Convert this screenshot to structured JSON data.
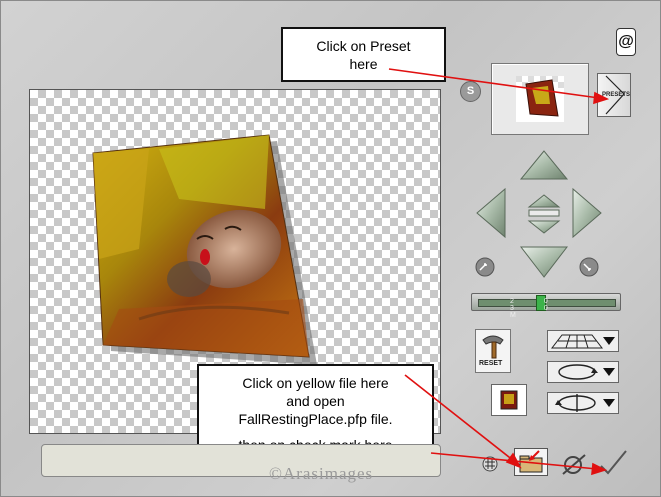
{
  "window": {
    "logo": "@"
  },
  "callouts": {
    "preset": {
      "lines": [
        "Click on Preset",
        "here"
      ]
    },
    "file": {
      "lines": [
        "Click on yellow file here",
        "and open",
        "FallRestingPlace.pfp file.",
        "then on check mark here"
      ]
    }
  },
  "panel": {
    "s_label": "S",
    "presets_label": "PRESETS",
    "reset_label": "RESET",
    "slider_marks": "2 0 3 0 M",
    "slider_value": 0.45
  },
  "status": {
    "watermark": "©Arasimages"
  },
  "icons": {
    "nav_up": "arrow-up-icon",
    "nav_down": "arrow-down-icon",
    "nav_left": "arrow-left-icon",
    "nav_right": "arrow-right-icon",
    "zoom_in": "zoom-in-icon",
    "zoom_out": "zoom-out-icon",
    "grid": "grid-icon",
    "rotate": "rotate-icon",
    "tilt": "tilt-icon",
    "file": "yellow-file-icon",
    "cancel": "cancel-icon",
    "ok": "check-mark-icon"
  },
  "colors": {
    "arrow_red": "#e01010",
    "nav_green": "#9fb89f",
    "slider_green": "#3cb34a"
  }
}
